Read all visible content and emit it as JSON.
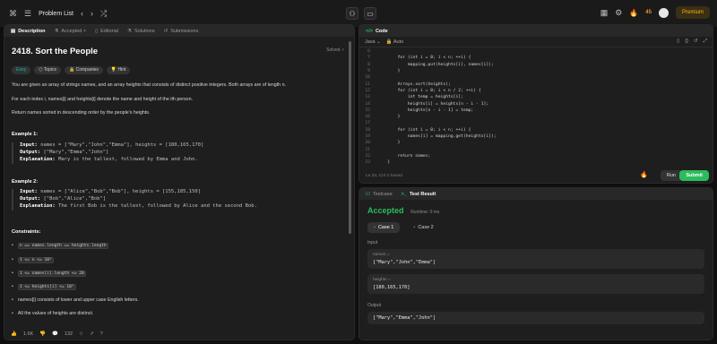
{
  "topbar": {
    "title": "Problem List",
    "streak": "45",
    "premium": "Premium"
  },
  "left": {
    "tabs": [
      {
        "label": "Description"
      },
      {
        "label": "Accepted"
      },
      {
        "label": "Editorial"
      },
      {
        "label": "Solutions"
      },
      {
        "label": "Submissions"
      }
    ],
    "title": "2418. Sort the People",
    "solved": "Solved",
    "pills": [
      "Easy",
      "Topics",
      "Companies",
      "Hint"
    ],
    "intro": "You are given an array of strings names, and an array heights that consists of distinct positive integers. Both arrays are of length n.",
    "intro2": "For each index i, names[i] and heights[i] denote the name and height of the ith person.",
    "intro3": "Return names sorted in descending order by the people's heights.",
    "example1": {
      "heading": "Example 1:",
      "input": "names = [\"Mary\",\"John\",\"Emma\"], heights = [180,165,170]",
      "output": "[\"Mary\",\"Emma\",\"John\"]",
      "explanation": "Mary is the tallest, followed by Emma and John."
    },
    "example2": {
      "heading": "Example 2:",
      "input": "names = [\"Alice\",\"Bob\",\"Bob\"], heights = [155,185,150]",
      "output": "[\"Bob\",\"Alice\",\"Bob\"]",
      "explanation": "The first Bob is the tallest, followed by Alice and the second Bob."
    },
    "constraints_heading": "Constraints:",
    "constraints": [
      "n == names.length == heights.length",
      "1 <= n <= 10³",
      "1 <= names[i].length <= 20",
      "1 <= heights[i] <= 10⁵",
      "names[i] consists of lower and upper case English letters.",
      "All the values of heights are distinct."
    ],
    "footer": {
      "likes": "1.6K",
      "comments": "132"
    }
  },
  "code": {
    "tab": "Code",
    "language": "Java",
    "mode": "Auto",
    "lines": [
      {
        "no": "6",
        "text": ""
      },
      {
        "no": "7",
        "text": "        for (int i = 0; i < n; ++i) {"
      },
      {
        "no": "8",
        "text": "            mapping.put(heights[i], names[i]);"
      },
      {
        "no": "9",
        "text": "        }"
      },
      {
        "no": "10",
        "text": ""
      },
      {
        "no": "11",
        "text": "        Arrays.sort(heights);"
      },
      {
        "no": "12",
        "text": "        for (int i = 0; i < n / 2; ++i) {"
      },
      {
        "no": "13",
        "text": "            int temp = heights[i];"
      },
      {
        "no": "14",
        "text": "            heights[i] = heights[n - i - 1];"
      },
      {
        "no": "15",
        "text": "            heights[n - i - 1] = temp;"
      },
      {
        "no": "16",
        "text": "        }"
      },
      {
        "no": "17",
        "text": ""
      },
      {
        "no": "18",
        "text": "        for (int i = 0; i < n; ++i) {"
      },
      {
        "no": "19",
        "text": "            names[i] = mapping.get(heights[i]);"
      },
      {
        "no": "20",
        "text": "        }"
      },
      {
        "no": "21",
        "text": ""
      },
      {
        "no": "22",
        "text": "        return names;"
      },
      {
        "no": "23",
        "text": "    }"
      }
    ],
    "status": "Ln 23, Col 2   Saved",
    "run": "Run",
    "submit": "Submit"
  },
  "result": {
    "tabs": [
      {
        "label": "Testcase"
      },
      {
        "label": "Test Result"
      }
    ],
    "status": "Accepted",
    "runtime": "Runtime: 0 ms",
    "cases": [
      "Case 1",
      "Case 2"
    ],
    "input_label": "Input",
    "names_key": "names =",
    "names_val": "[\"Mary\",\"John\",\"Emma\"]",
    "heights_key": "heights =",
    "heights_val": "[180,165,170]",
    "output_label": "Output",
    "output_val": "[\"Mary\",\"Emma\",\"John\"]"
  }
}
